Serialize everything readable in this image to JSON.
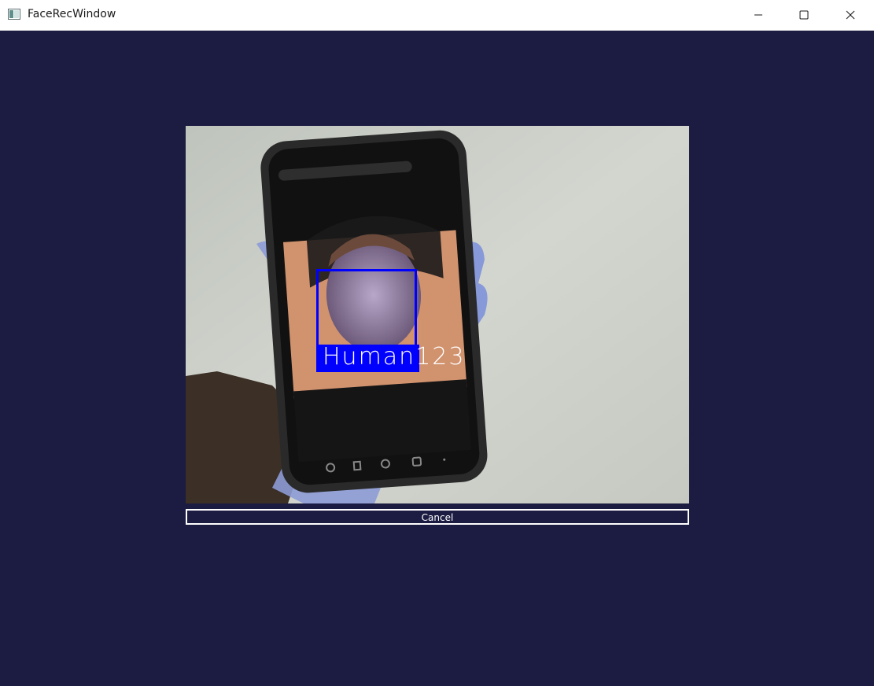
{
  "window": {
    "title": "FaceRecWindow",
    "app_icon": "window-app-icon",
    "controls": {
      "minimize_icon": "minimize-icon",
      "maximize_icon": "maximize-icon",
      "close_icon": "close-icon"
    }
  },
  "camera": {
    "detection_label": "Human123",
    "box_color": "#0000ff"
  },
  "actions": {
    "cancel_label": "Cancel"
  },
  "colors": {
    "background": "#1c1b41",
    "titlebar": "#ffffff"
  }
}
